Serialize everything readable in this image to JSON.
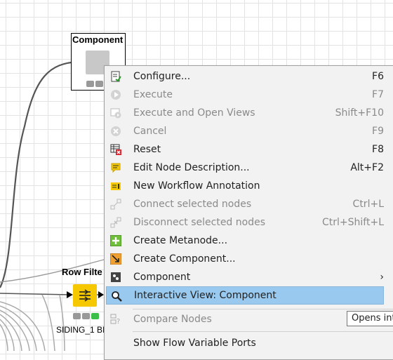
{
  "canvas": {
    "component_node": {
      "title": "Component"
    },
    "row_filter_node": {
      "title": "Row Filte",
      "label": "SIDING_1 BI"
    }
  },
  "context_menu": {
    "items": [
      {
        "label": "Configure...",
        "shortcut": "F6",
        "icon": "configure-icon",
        "enabled": true
      },
      {
        "label": "Execute",
        "shortcut": "F7",
        "icon": "execute-icon",
        "enabled": false
      },
      {
        "label": "Execute and Open Views",
        "shortcut": "Shift+F10",
        "icon": "execute-open-views-icon",
        "enabled": false
      },
      {
        "label": "Cancel",
        "shortcut": "F9",
        "icon": "cancel-icon",
        "enabled": false
      },
      {
        "label": "Reset",
        "shortcut": "F8",
        "icon": "reset-icon",
        "enabled": true
      },
      {
        "label": "Edit Node Description...",
        "shortcut": "Alt+F2",
        "icon": "edit-description-icon",
        "enabled": true
      },
      {
        "label": "New Workflow Annotation",
        "shortcut": "",
        "icon": "annotation-icon",
        "enabled": true
      },
      {
        "label": "Connect selected nodes",
        "shortcut": "Ctrl+L",
        "icon": "connect-nodes-icon",
        "enabled": false
      },
      {
        "label": "Disconnect selected nodes",
        "shortcut": "Ctrl+Shift+L",
        "icon": "disconnect-nodes-icon",
        "enabled": false
      },
      {
        "label": "Create Metanode...",
        "shortcut": "",
        "icon": "create-metanode-icon",
        "enabled": true
      },
      {
        "label": "Create Component...",
        "shortcut": "",
        "icon": "create-component-icon",
        "enabled": true
      },
      {
        "label": "Component",
        "shortcut": "›",
        "icon": "component-submenu-icon",
        "enabled": true
      },
      {
        "label": "Interactive View: Component",
        "shortcut": "",
        "icon": "magnifier-icon",
        "enabled": true,
        "highlighted": true
      },
      {
        "label": "Compare Nodes",
        "shortcut": "",
        "icon": "compare-nodes-icon",
        "enabled": false
      },
      {
        "label": "Show Flow Variable Ports",
        "shortcut": "",
        "icon": "",
        "enabled": true
      }
    ]
  },
  "tooltip": {
    "text": "Opens int"
  },
  "colors": {
    "highlight": "#99c9ef",
    "node_yellow": "#f5c800",
    "status_green": "#3bbf4a"
  }
}
